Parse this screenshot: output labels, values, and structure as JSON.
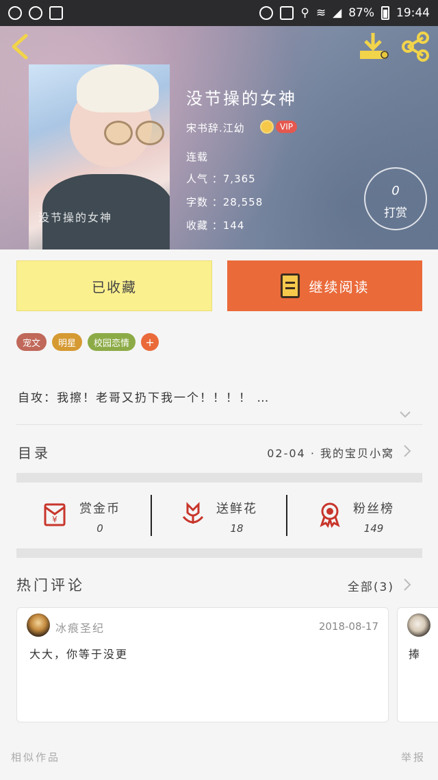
{
  "status_bar": {
    "battery": "87%",
    "time": "19:44"
  },
  "book": {
    "cover_text": "没节操的女神",
    "title": "没节操的女神",
    "author": "宋书辞.江幼",
    "vip": "VIP",
    "status": "连载",
    "popularity": "人气 ：7,365",
    "word_count": "字数 ：28,558",
    "favorites": "收藏 ：144"
  },
  "tip": {
    "count": "0",
    "label": "打赏"
  },
  "actions": {
    "collected": "已收藏",
    "continue_reading": "继续阅读"
  },
  "tags": [
    {
      "label": "宠文",
      "color": "#c0685a"
    },
    {
      "label": "明星",
      "color": "#d59a32"
    },
    {
      "label": "校园恋情",
      "color": "#8cab46"
    }
  ],
  "tag_add": "+",
  "intro": "自攻：我擦！老哥又扔下我一个！！！！  …",
  "toc": {
    "label": "目录",
    "latest": "02-04 · 我的宝贝小窝"
  },
  "stats": [
    {
      "label": "赏金币",
      "value": "0",
      "icon": "red-envelope-icon"
    },
    {
      "label": "送鲜花",
      "value": "18",
      "icon": "flower-icon"
    },
    {
      "label": "粉丝榜",
      "value": "149",
      "icon": "medal-icon"
    }
  ],
  "hot_comments": {
    "title": "热门评论",
    "all": "全部(3)"
  },
  "comments": [
    {
      "user": "冰痕圣纪",
      "date": "2018-08-17",
      "text": "大大，你等于没更"
    },
    {
      "text": "捧"
    }
  ],
  "footer": {
    "similar": "相似作品",
    "report": "举报"
  },
  "colors": {
    "accent": "#ea6a3a",
    "collected_bg": "#fbf08e",
    "icon_red": "#c8352b",
    "header_icon": "#f2d44a"
  }
}
